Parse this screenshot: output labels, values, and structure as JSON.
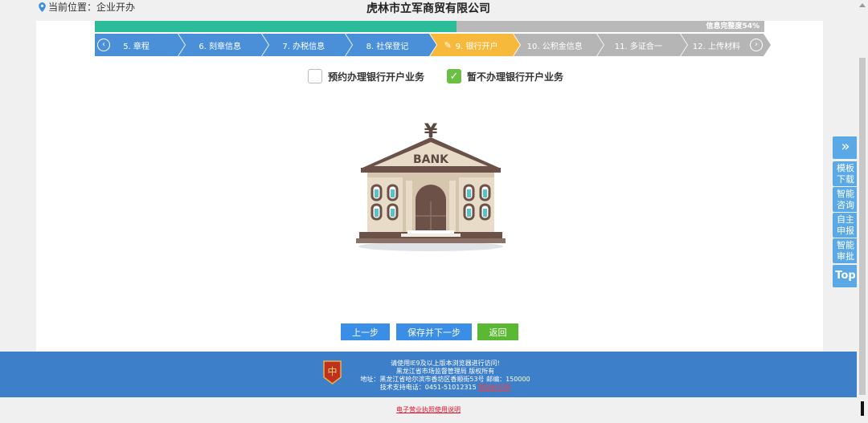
{
  "location": {
    "label": "当前位置：企业开办"
  },
  "company_name": "虎林市立军商贸有限公司",
  "progress": {
    "text": "信息完整度54%",
    "percent": 54
  },
  "steps": [
    {
      "label": "5. 章程",
      "state": "done"
    },
    {
      "label": "6. 刻章信息",
      "state": "done"
    },
    {
      "label": "7. 办税信息",
      "state": "done"
    },
    {
      "label": "8. 社保登记",
      "state": "done"
    },
    {
      "label": "9. 银行开户",
      "state": "active"
    },
    {
      "label": "10. 公积金信息",
      "state": "todo"
    },
    {
      "label": "11. 多证合一",
      "state": "todo"
    },
    {
      "label": "12. 上传材料",
      "state": "todo"
    }
  ],
  "options": {
    "reserve": {
      "label": "预约办理银行开户业务",
      "checked": false
    },
    "skip": {
      "label": "暂不办理银行开户业务",
      "checked": true
    }
  },
  "bank_illustration": {
    "sign": "BANK",
    "symbol": "¥"
  },
  "buttons": {
    "prev": "上一步",
    "save_next": "保存并下一步",
    "back": "返回"
  },
  "footer": {
    "line1": "请使用IE9及以上版本浏览器进行访问!",
    "line2": "黑龙江省市场监督管理局 版权所有",
    "line3": "地址：黑龙江省哈尔滨市香坊区香顺街53号 邮编：150000",
    "line4_prefix": "技术支持电话：0451-51012315 ",
    "line4_link": "网站标识码"
  },
  "bottom_link": "电子营业执照使用说明",
  "sidebar": {
    "expand_icon": "»",
    "items": [
      "模板下载",
      "智能咨询",
      "自主申报",
      "智能审批"
    ],
    "top": "Top"
  },
  "colors": {
    "progress_fill": "#2bbd9a",
    "step_done": "#4a90d9",
    "step_active": "#f7b93c",
    "step_todo": "#b5b5b5",
    "checkbox_checked": "#6bbf45",
    "footer_bg": "#3d7fc9",
    "side_bg": "#5aa9e6"
  }
}
